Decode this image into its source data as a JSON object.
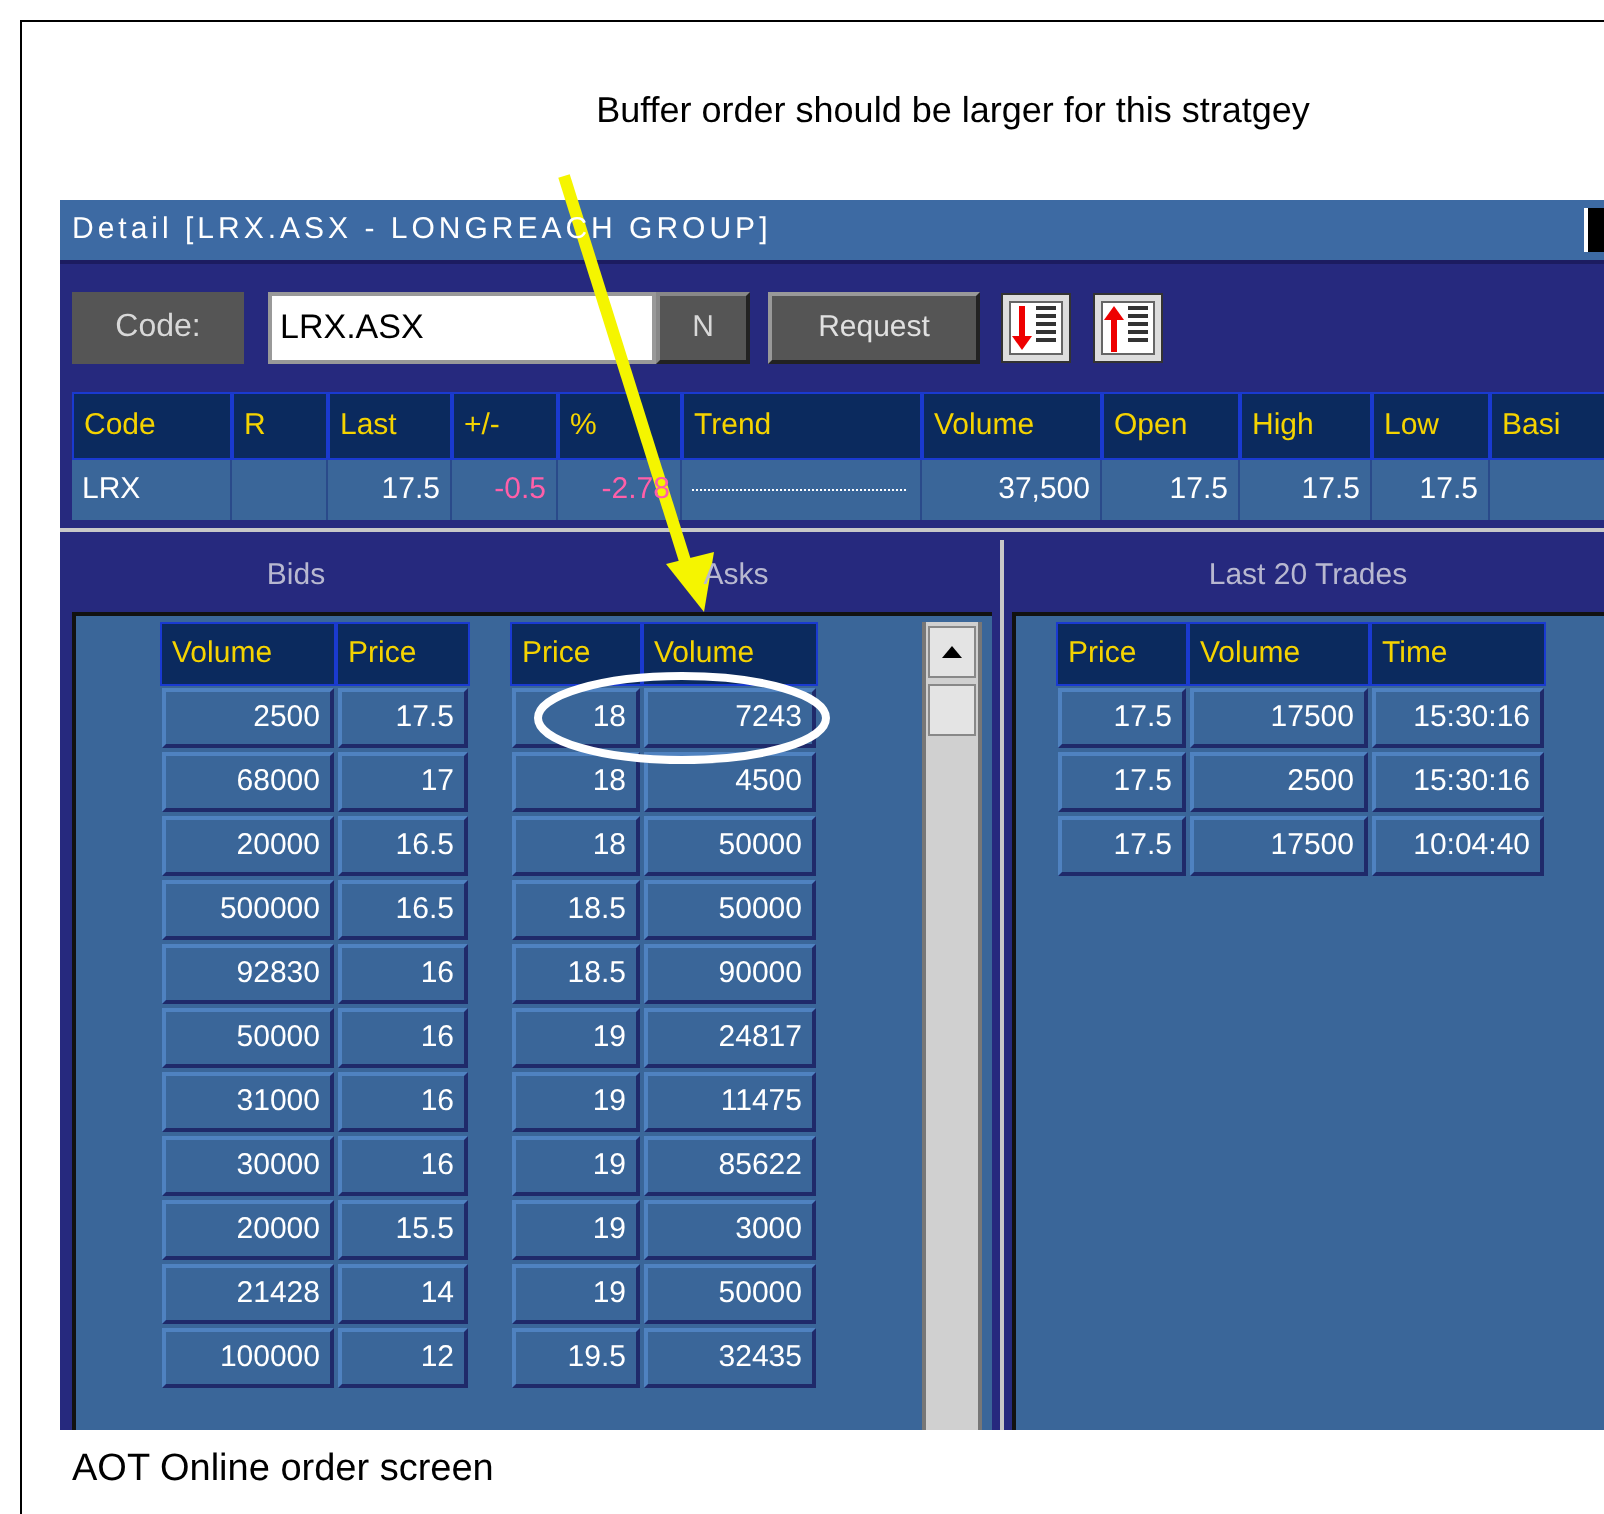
{
  "annotation": {
    "caption": "Buffer order should be larger for this stratgey"
  },
  "window": {
    "title": "Detail [LRX.ASX - LONGREACH GROUP]"
  },
  "toolbar": {
    "code_label": "Code:",
    "code_value": "LRX.ASX",
    "n_button": "N",
    "request_button": "Request"
  },
  "quote": {
    "columns": [
      "Code",
      "R",
      "Last",
      "+/-",
      "%",
      "Trend",
      "Volume",
      "Open",
      "High",
      "Low",
      "Basi"
    ],
    "row": [
      {
        "kind": "text",
        "text": "LRX"
      },
      {
        "kind": "blank"
      },
      {
        "kind": "text",
        "text": "17.5"
      },
      {
        "kind": "negative",
        "text": "-0.5"
      },
      {
        "kind": "negative",
        "text": "-2.78"
      },
      {
        "kind": "trend"
      },
      {
        "kind": "text",
        "text": "37,500"
      },
      {
        "kind": "text",
        "text": "17.5"
      },
      {
        "kind": "text",
        "text": "17.5"
      },
      {
        "kind": "text",
        "text": "17.5"
      },
      {
        "kind": "blank"
      }
    ]
  },
  "depth": {
    "bids_title": "Bids",
    "asks_title": "Asks",
    "bid_columns": [
      "Volume",
      "Price"
    ],
    "ask_columns": [
      "Price",
      "Volume"
    ],
    "bids": [
      [
        "2500",
        "17.5"
      ],
      [
        "68000",
        "17"
      ],
      [
        "20000",
        "16.5"
      ],
      [
        "500000",
        "16.5"
      ],
      [
        "92830",
        "16"
      ],
      [
        "50000",
        "16"
      ],
      [
        "31000",
        "16"
      ],
      [
        "30000",
        "16"
      ],
      [
        "20000",
        "15.5"
      ],
      [
        "21428",
        "14"
      ],
      [
        "100000",
        "12"
      ]
    ],
    "asks": [
      [
        "18",
        "7243"
      ],
      [
        "18",
        "4500"
      ],
      [
        "18",
        "50000"
      ],
      [
        "18.5",
        "50000"
      ],
      [
        "18.5",
        "90000"
      ],
      [
        "19",
        "24817"
      ],
      [
        "19",
        "11475"
      ],
      [
        "19",
        "85622"
      ],
      [
        "19",
        "3000"
      ],
      [
        "19",
        "50000"
      ],
      [
        "19.5",
        "32435"
      ]
    ]
  },
  "trades": {
    "title": "Last 20 Trades",
    "columns": [
      "Price",
      "Volume",
      "Time"
    ],
    "rows": [
      [
        "17.5",
        "17500",
        "15:30:16"
      ],
      [
        "17.5",
        "2500",
        "15:30:16"
      ],
      [
        "17.5",
        "17500",
        "10:04:40"
      ]
    ]
  },
  "footer": {
    "caption": "AOT Online order screen"
  }
}
